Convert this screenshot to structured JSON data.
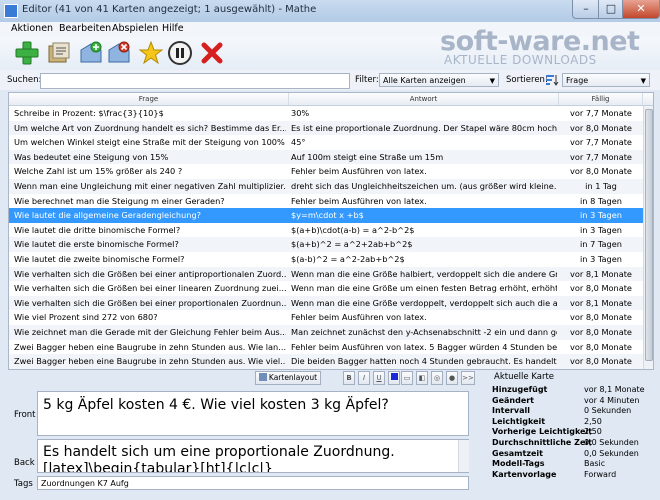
{
  "window": {
    "title": "Editor (41 von 41 Karten angezeigt; 1 ausgewählt) - Mathe",
    "buttons": {
      "minimize": "–",
      "maximize": "□",
      "close": "✕"
    }
  },
  "menu": [
    "Aktionen",
    "Bearbeiten",
    "Abspielen",
    "Hilfe"
  ],
  "toolbar": {
    "icons": [
      "add-card-icon",
      "import-icon",
      "tag-add-icon",
      "tag-remove-icon",
      "star-icon",
      "pause-icon",
      "delete-icon"
    ]
  },
  "watermark": {
    "line1": "soft-ware.net",
    "line2": "AKTUELLE DOWNLOADS"
  },
  "search": {
    "label": "Suchen:",
    "value": "",
    "filter_label": "Filter:",
    "filter_value": "Alle Karten anzeigen",
    "sort_label": "Sortieren:",
    "sort_value": "Frage"
  },
  "table": {
    "headers": [
      "Frage",
      "Antwort",
      "Fällig"
    ],
    "selected_index": 7,
    "rows": [
      {
        "q": "Schreibe in Prozent:  $\\frac{3}{10}$",
        "a": "30%",
        "due": "vor 7,7 Monate"
      },
      {
        "q": "Um welche Art von Zuordnung handelt es sich? Bestimme das Er...",
        "a": "Es ist eine proportionale Zuordnung. Der Stapel wäre 80cm hoch",
        "due": "vor 8,0 Monate"
      },
      {
        "q": "Um welchen Winkel steigt eine Straße mit der Steigung von 100%",
        "a": "45°",
        "due": "vor 7,7 Monate"
      },
      {
        "q": "Was bedeutet eine Steigung von 15%",
        "a": "Auf 100m steigt eine Straße um 15m",
        "due": "vor 7,7 Monate"
      },
      {
        "q": "Welche Zahl ist um 15% größer als 240 ?",
        "a": "Fehler beim Ausführen von latex.",
        "due": "vor 8,0 Monate"
      },
      {
        "q": "Wenn man eine Ungleichung mit einer negativen Zahl multiplizier...",
        "a": "dreht sich das Ungleichheitszeichen um. (aus größer wird kleine...",
        "due": "in 1 Tag"
      },
      {
        "q": "Wie berechnet man die Steigung m einer Geraden?",
        "a": "Fehler beim Ausführen von latex.",
        "due": "in 8 Tagen"
      },
      {
        "q": "Wie lautet die allgemeine Geradengleichung?",
        "a": "$y=m\\cdot x +b$",
        "due": "in 3 Tagen"
      },
      {
        "q": "Wie lautet die dritte binomische Formel?",
        "a": "$(a+b)\\cdot(a-b) = a^2-b^2$",
        "due": "in 3 Tagen"
      },
      {
        "q": "Wie lautet die erste binomische Formel?",
        "a": "$(a+b)^2 = a^2+2ab+b^2$",
        "due": "in 7 Tagen"
      },
      {
        "q": "Wie lautet die zweite binomische Formel?",
        "a": "$(a-b)^2 = a^2-2ab+b^2$",
        "due": "in 3 Tagen"
      },
      {
        "q": "Wie verhalten sich die Größen bei einer antiproportionalen Zuord...",
        "a": "Wenn man die eine Größe halbiert, verdoppelt sich die andere Gr...",
        "due": "vor 8,1 Monate"
      },
      {
        "q": "Wie verhalten sich die Größen bei einer linearen Zuordnung zuei...",
        "a": "Wenn man die eine Größe um einen festen Betrag erhöht, erhöht...",
        "due": "vor 8,0 Monate"
      },
      {
        "q": "Wie verhalten sich die Größen bei einer proportionalen Zuordnun...",
        "a": "Wenn man die eine Größe verdoppelt, verdoppelt sich auch die a...",
        "due": "vor 8,1 Monate"
      },
      {
        "q": "Wie viel Prozent sind 272 von 680?",
        "a": "Fehler beim Ausführen von latex.",
        "due": "vor 8,0 Monate"
      },
      {
        "q": "Wie zeichnet man die Gerade mit der Gleichung  Fehler beim Aus...",
        "a": "Man zeichnet zunächst den y-Achsenabschnitt -2 ein und dann ge...",
        "due": "vor 8,0 Monate"
      },
      {
        "q": "Zwei Bagger heben eine Baugrube in zehn Stunden aus. Wie lan...",
        "a": "Fehler beim Ausführen von latex.  5 Bagger würden 4 Stunden be...",
        "due": "vor 8,0 Monate"
      },
      {
        "q": "Zwei Bagger heben eine Baugrube in zehn Stunden aus. Wie viel...",
        "a": "Die beiden Bagger hatten noch 4 Stunden gebraucht. Es handelt ...",
        "due": "vor 8,0 Monate"
      }
    ]
  },
  "card_toolbar": {
    "layout_label": "Kartenlayout",
    "format_buttons": [
      "B",
      "I",
      "U"
    ],
    "more": ">>"
  },
  "editor": {
    "front_label": "Front",
    "front_text": "5 kg Äpfel kosten 4 €. Wie viel kosten 3 kg Äpfel?",
    "back_label": "Back",
    "back_text": "Es handelt sich um eine proportionale Zuordnung.",
    "back_text2": "[latex]\\begin{tabular}[ht]{|c|c|}",
    "tags_label": "Tags",
    "tags_value": "Zuordnungen K7 Aufg"
  },
  "current_card": {
    "title": "Aktuelle Karte",
    "rows": [
      {
        "k": "Hinzugefügt",
        "v": "vor 8,1 Monate"
      },
      {
        "k": "Geändert",
        "v": "vor 4 Minuten"
      },
      {
        "k": "Intervall",
        "v": "0 Sekunden"
      },
      {
        "k": "Leichtigkeit",
        "v": "2,50"
      },
      {
        "k": "Vorherige Leichtigkeit",
        "v": "2,50"
      },
      {
        "k": "Durchschnittliche Zeit",
        "v": "0,0 Sekunden"
      },
      {
        "k": "Gesamtzeit",
        "v": "0,0 Sekunden"
      },
      {
        "k": "Modell-Tags",
        "v": "Basic"
      },
      {
        "k": "Kartenvorlage",
        "v": "Forward"
      }
    ]
  },
  "colors": {
    "selection": "#3399ff",
    "accent": "#3a7bd5"
  }
}
